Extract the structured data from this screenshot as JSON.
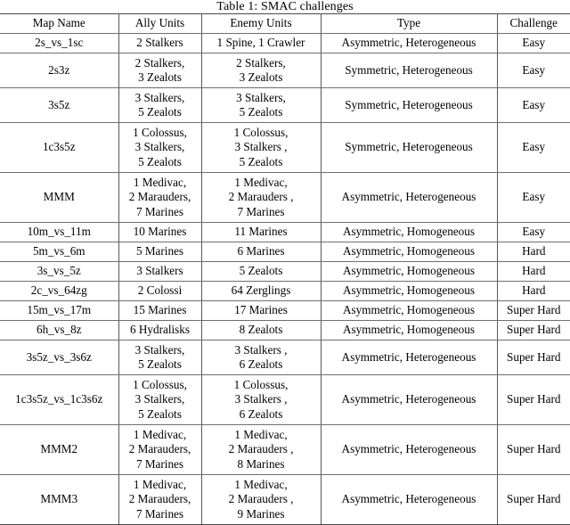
{
  "caption": "Table 1: SMAC challenges",
  "table": {
    "columns": [
      "Map Name",
      "Ally Units",
      "Enemy Units",
      "Type",
      "Challenge"
    ],
    "rows": [
      {
        "map": "2s_vs_1sc",
        "ally": [
          "2 Stalkers"
        ],
        "enemy": [
          "1 Spine, 1 Crawler"
        ],
        "type": "Asymmetric, Heterogeneous",
        "challenge": "Easy"
      },
      {
        "map": "2s3z",
        "ally": [
          "2 Stalkers,",
          "3 Zealots"
        ],
        "enemy": [
          "2 Stalkers,",
          "3 Zealots"
        ],
        "type": "Symmetric, Heterogeneous",
        "challenge": "Easy"
      },
      {
        "map": "3s5z",
        "ally": [
          "3 Stalkers,",
          "5 Zealots"
        ],
        "enemy": [
          "3 Stalkers,",
          "5 Zealots"
        ],
        "type": "Symmetric, Heterogeneous",
        "challenge": "Easy"
      },
      {
        "map": "1c3s5z",
        "ally": [
          "1 Colossus,",
          "3 Stalkers,",
          "5 Zealots"
        ],
        "enemy": [
          "1 Colossus,",
          "3 Stalkers ,",
          "5 Zealots"
        ],
        "type": "Symmetric, Heterogeneous",
        "challenge": "Easy"
      },
      {
        "map": "MMM",
        "ally": [
          "1 Medivac,",
          "2 Marauders,",
          "7 Marines"
        ],
        "enemy": [
          "1 Medivac,",
          "2 Marauders ,",
          "7 Marines"
        ],
        "type": "Asymmetric, Heterogeneous",
        "challenge": "Easy"
      },
      {
        "map": "10m_vs_11m",
        "ally": [
          "10 Marines"
        ],
        "enemy": [
          "11 Marines"
        ],
        "type": "Asymmetric, Homogeneous",
        "challenge": "Easy"
      },
      {
        "map": "5m_vs_6m",
        "ally": [
          "5 Marines"
        ],
        "enemy": [
          "6 Marines"
        ],
        "type": "Asymmetric, Homogeneous",
        "challenge": "Hard"
      },
      {
        "map": "3s_vs_5z",
        "ally": [
          "3 Stalkers"
        ],
        "enemy": [
          "5 Zealots"
        ],
        "type": "Asymmetric, Homogeneous",
        "challenge": "Hard"
      },
      {
        "map": "2c_vs_64zg",
        "ally": [
          "2 Colossi"
        ],
        "enemy": [
          "64 Zerglings"
        ],
        "type": "Asymmetric, Homogeneous",
        "challenge": "Hard"
      },
      {
        "map": "15m_vs_17m",
        "ally": [
          "15 Marines"
        ],
        "enemy": [
          "17 Marines"
        ],
        "type": "Asymmetric, Homogeneous",
        "challenge": "Super Hard"
      },
      {
        "map": "6h_vs_8z",
        "ally": [
          "6 Hydralisks"
        ],
        "enemy": [
          "8 Zealots"
        ],
        "type": "Asymmetric, Homogeneous",
        "challenge": "Super Hard"
      },
      {
        "map": "3s5z_vs_3s6z",
        "ally": [
          "3 Stalkers,",
          "5 Zealots"
        ],
        "enemy": [
          "3 Stalkers ,",
          "6 Zealots"
        ],
        "type": "Asymmetric, Heterogeneous",
        "challenge": "Super Hard"
      },
      {
        "map": "1c3s5z_vs_1c3s6z",
        "ally": [
          "1 Colossus,",
          "3 Stalkers,",
          "5 Zealots"
        ],
        "enemy": [
          "1 Colossus,",
          "3 Stalkers ,",
          "6 Zealots"
        ],
        "type": "Asymmetric, Heterogeneous",
        "challenge": "Super Hard"
      },
      {
        "map": "MMM2",
        "ally": [
          "1 Medivac,",
          "2 Marauders,",
          "7 Marines"
        ],
        "enemy": [
          "1 Medivac,",
          "2 Marauders ,",
          "8 Marines"
        ],
        "type": "Asymmetric, Heterogeneous",
        "challenge": "Super Hard"
      },
      {
        "map": "MMM3",
        "ally": [
          "1 Medivac,",
          "2 Marauders,",
          "7 Marines"
        ],
        "enemy": [
          "1 Medivac,",
          "2 Marauders ,",
          "9 Marines"
        ],
        "type": "Asymmetric, Heterogeneous",
        "challenge": "Super Hard"
      }
    ]
  }
}
